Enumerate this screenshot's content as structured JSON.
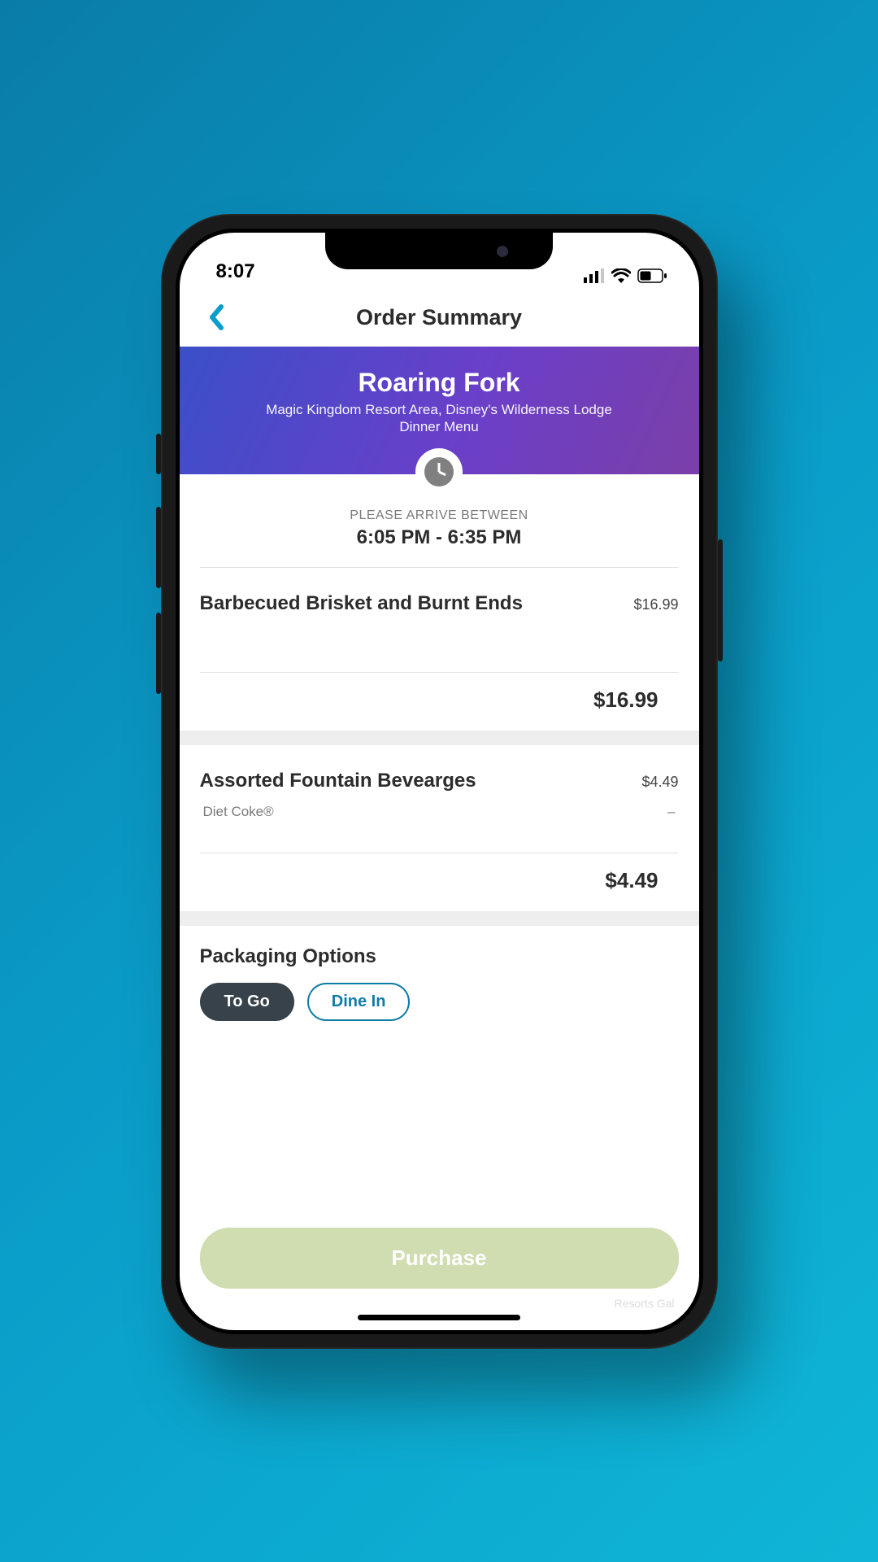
{
  "status": {
    "time": "8:07"
  },
  "nav": {
    "title": "Order Summary"
  },
  "restaurant": {
    "name": "Roaring Fork",
    "location": "Magic Kingdom Resort Area, Disney's Wilderness Lodge",
    "menu": "Dinner Menu"
  },
  "arrival": {
    "label": "PLEASE ARRIVE BETWEEN",
    "window": "6:05 PM - 6:35 PM"
  },
  "items": [
    {
      "name": "Barbecued Brisket and Burnt Ends",
      "price": "$16.99",
      "subtotal": "$16.99"
    },
    {
      "name": "Assorted Fountain Bevearges",
      "price": "$4.49",
      "option_label": "Diet Coke®",
      "option_value": "–",
      "subtotal": "$4.49"
    }
  ],
  "packaging": {
    "title": "Packaging Options",
    "options": {
      "togo": "To Go",
      "dinein": "Dine In"
    }
  },
  "cta": {
    "purchase": "Purchase"
  },
  "watermark": "Resorts Gal"
}
